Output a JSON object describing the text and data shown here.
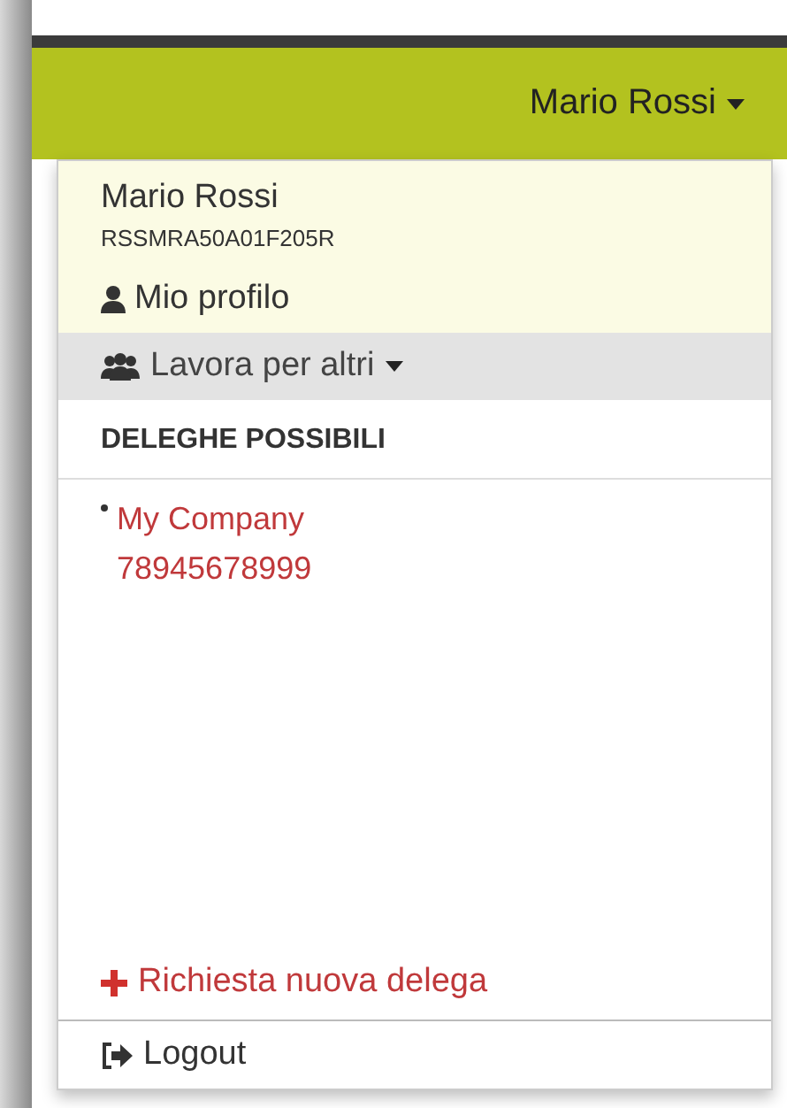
{
  "header": {
    "user_menu": {
      "label": "Mario Rossi",
      "expanded": true
    }
  },
  "menu": {
    "name": "Mario Rossi",
    "fiscal_code": "RSSMRA50A01F205R",
    "profile_link": "Mio profilo",
    "work_for_others": {
      "label": "Lavora per altri",
      "expanded": true
    },
    "section_title": "DELEGHE POSSIBILI",
    "delegations": [
      {
        "company": "My Company",
        "code": "78945678999"
      }
    ],
    "new_delegation": "Richiesta nuova delega",
    "logout": "Logout"
  }
}
